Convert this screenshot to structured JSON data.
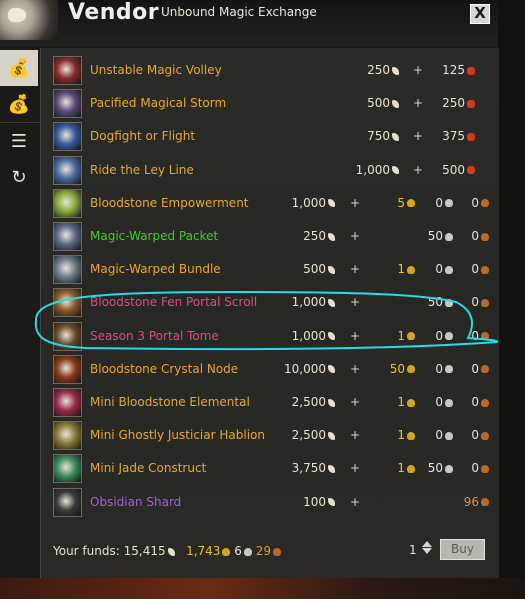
{
  "window": {
    "title": "Vendor",
    "subtitle": "Unbound Magic Exchange",
    "close_label": "X"
  },
  "tabs": [
    {
      "icon": "bag-icon",
      "active": true
    },
    {
      "icon": "bag-icon",
      "active": false
    },
    {
      "icon": "coins-stack-icon",
      "active": false
    },
    {
      "icon": "buyback-icon",
      "active": false
    }
  ],
  "items": [
    {
      "name": "Unstable Magic Volley",
      "color": "#e8a83a",
      "magic": "250",
      "plus": "+",
      "volatile": "125",
      "gold": "",
      "silver": "",
      "copper": ""
    },
    {
      "name": "Pacified Magical Storm",
      "color": "#e8a83a",
      "magic": "500",
      "plus": "+",
      "volatile": "250",
      "gold": "",
      "silver": "",
      "copper": ""
    },
    {
      "name": "Dogfight or Flight",
      "color": "#e8a83a",
      "magic": "750",
      "plus": "+",
      "volatile": "375",
      "gold": "",
      "silver": "",
      "copper": ""
    },
    {
      "name": "Ride the Ley Line",
      "color": "#e8a83a",
      "magic": "1,000",
      "plus": "+",
      "volatile": "500",
      "gold": "",
      "silver": "",
      "copper": ""
    },
    {
      "name": "Bloodstone Empowerment",
      "color": "#e8a83a",
      "magic": "1,000",
      "plus": "+",
      "volatile": "",
      "gold": "5",
      "silver": "0",
      "copper": "0"
    },
    {
      "name": "Magic-Warped Packet",
      "color": "#3fcf2a",
      "magic": "250",
      "plus": "+",
      "volatile": "",
      "gold": "",
      "silver": "50",
      "copper": "0"
    },
    {
      "name": "Magic-Warped Bundle",
      "color": "#e8a83a",
      "magic": "500",
      "plus": "+",
      "volatile": "",
      "gold": "1",
      "silver": "0",
      "copper": "0"
    },
    {
      "name": "Bloodstone Fen Portal Scroll",
      "color": "#e04a8a",
      "magic": "1,000",
      "plus": "+",
      "volatile": "",
      "gold": "",
      "silver": "50",
      "copper": "0"
    },
    {
      "name": "Season 3 Portal Tome",
      "color": "#e04a8a",
      "magic": "1,000",
      "plus": "+",
      "volatile": "",
      "gold": "1",
      "silver": "0",
      "copper": "0"
    },
    {
      "name": "Bloodstone Crystal Node",
      "color": "#e8a83a",
      "magic": "10,000",
      "plus": "+",
      "volatile": "",
      "gold": "50",
      "silver": "0",
      "copper": "0"
    },
    {
      "name": "Mini Bloodstone Elemental",
      "color": "#e8a83a",
      "magic": "2,500",
      "plus": "+",
      "volatile": "",
      "gold": "1",
      "silver": "0",
      "copper": "0"
    },
    {
      "name": "Mini Ghostly Justiciar Hablion",
      "color": "#e8a83a",
      "magic": "2,500",
      "plus": "+",
      "volatile": "",
      "gold": "1",
      "silver": "0",
      "copper": "0"
    },
    {
      "name": "Mini Jade Construct",
      "color": "#e8a83a",
      "magic": "3,750",
      "plus": "+",
      "volatile": "",
      "gold": "1",
      "silver": "50",
      "copper": "0"
    },
    {
      "name": "Obsidian Shard",
      "color": "#a65fe0",
      "magic": "100",
      "plus": "+",
      "volatile": "",
      "gold": "",
      "silver": "",
      "copper": "96"
    }
  ],
  "funds": {
    "label": "Your funds:",
    "magic": "15,415",
    "gold": "1,743",
    "silver": "6",
    "copper": "29"
  },
  "purchase": {
    "quantity": "1",
    "buy_label": "Buy"
  },
  "icon_colors": [
    "#8a2a2a",
    "#5a4a7a",
    "#3a5a9a",
    "#4a6aa0",
    "#8aa83a",
    "#5a6a8a",
    "#6a7a8a",
    "#8a5a2a",
    "#6a4a2a",
    "#8a3a1a",
    "#9a2a4a",
    "#8a7a3a",
    "#3a8a5a",
    "#3a3a3a"
  ],
  "highlight_color": "#2ad8e8"
}
